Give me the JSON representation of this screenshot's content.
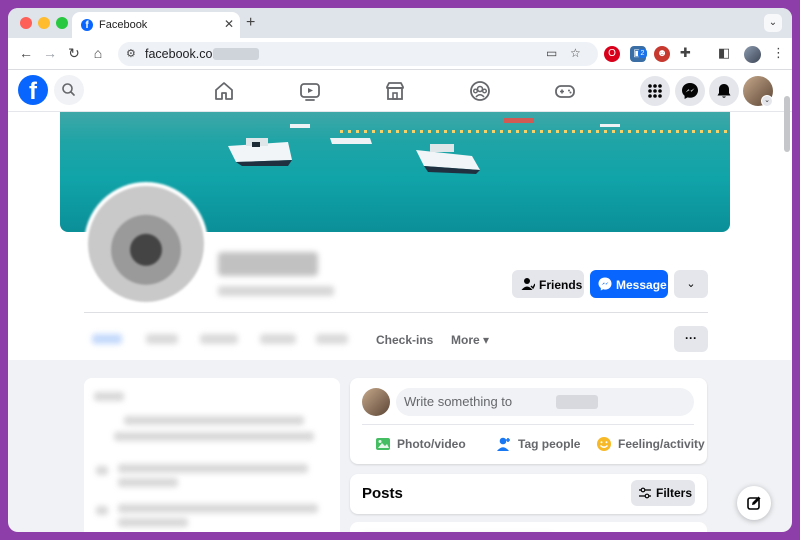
{
  "browser": {
    "tab_title": "Facebook",
    "tab_close": "✕",
    "new_tab": "+",
    "tab_menu": "⌄",
    "url": "facebook.com/",
    "nav": {
      "back": "←",
      "forward": "→",
      "reload": "↻",
      "home": "⌂"
    },
    "toolbar_icons": [
      "install-icon",
      "bookmark-star-icon",
      "extensions-icon",
      "side-panel-icon",
      "menu-icon"
    ],
    "extension_badge": "2",
    "menu": "⋮"
  },
  "fb": {
    "logo": "f",
    "nav_icons": [
      "home-icon",
      "watch-icon",
      "marketplace-icon",
      "groups-icon",
      "gaming-icon"
    ],
    "right_icons": [
      "menu-grid-icon",
      "messenger-icon",
      "notifications-bell-icon"
    ],
    "accent": "#0866ff"
  },
  "profile": {
    "friends_label": "Friends",
    "message_label": "Message",
    "more_label": "⌄",
    "tabs": {
      "checkins": "Check-ins",
      "more": "More ▾"
    },
    "ellipsis": "···"
  },
  "composer": {
    "placeholder": "Write something to",
    "actions": {
      "photo": "Photo/video",
      "tag": "Tag people",
      "feeling": "Feeling/activity"
    }
  },
  "posts": {
    "title": "Posts",
    "filters_label": "Filters"
  }
}
